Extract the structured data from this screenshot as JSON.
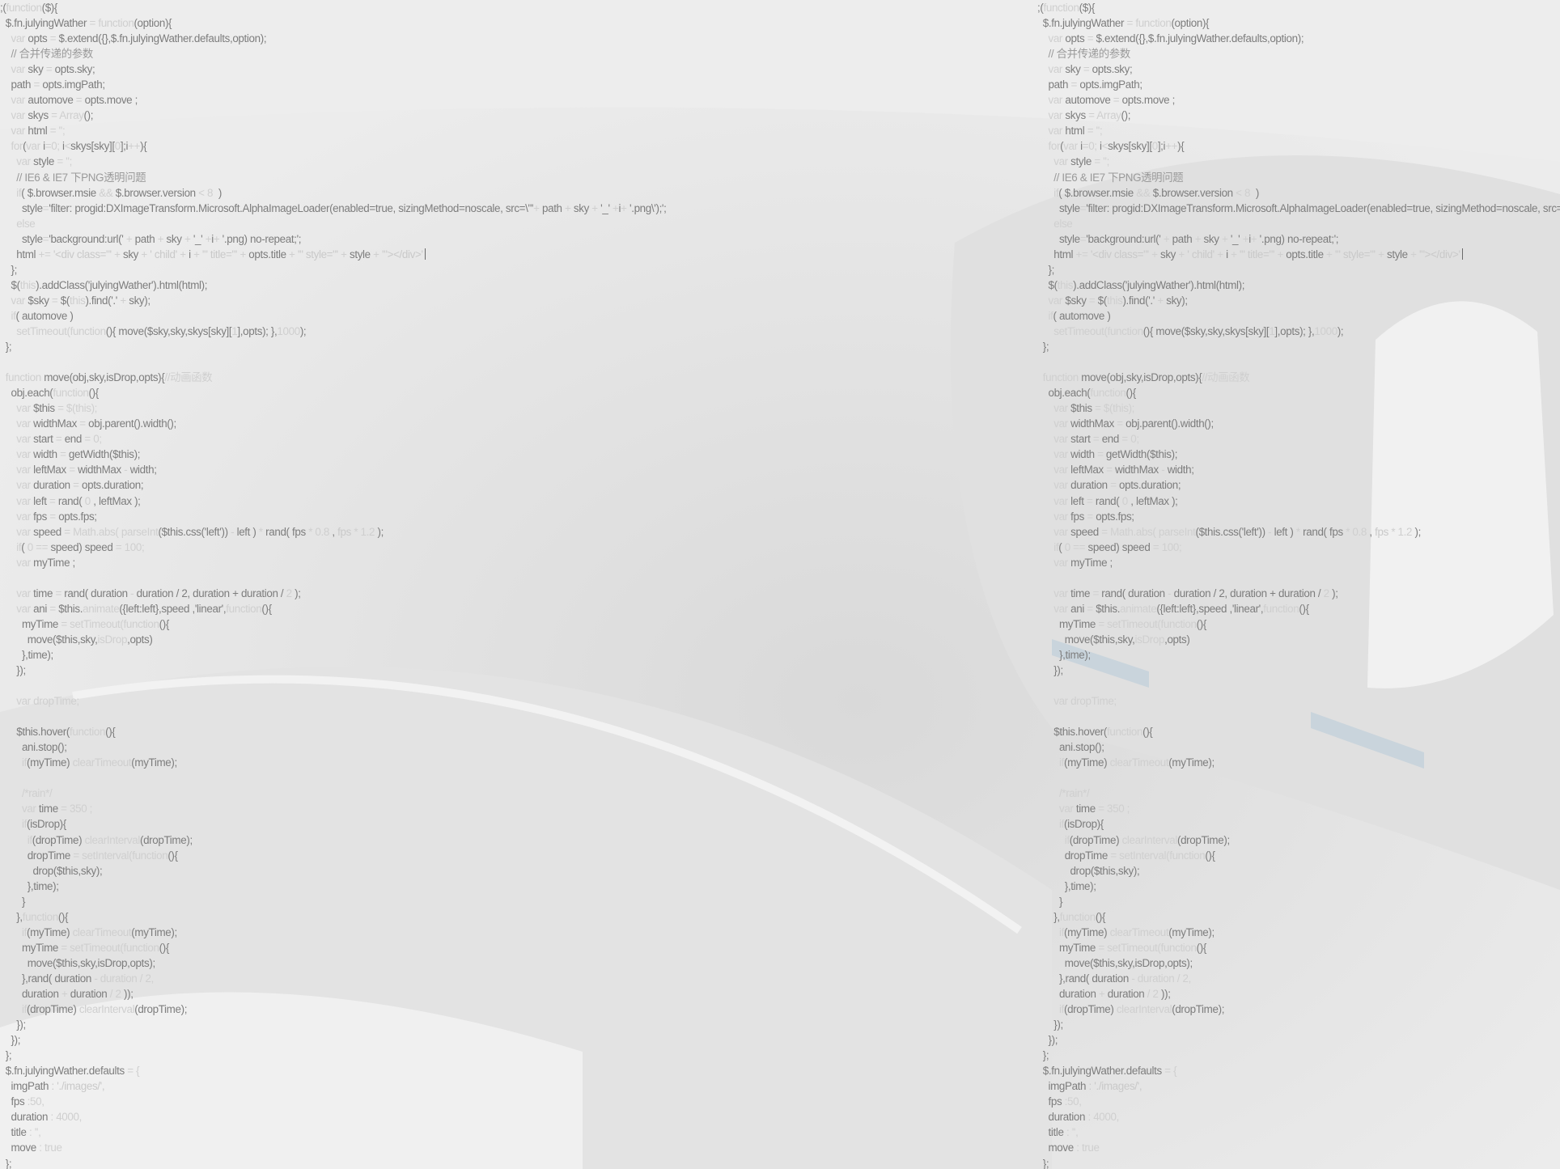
{
  "colors": {
    "background": "#e9e9e9",
    "code_text": "#7d7d7d",
    "keyword": "#cfcfcf",
    "string": "#c9c9c9",
    "comment": "#9a9a9a"
  },
  "code_lines": [
    [
      [
        ";(",
        ""
      ],
      [
        "function",
        "kw"
      ],
      [
        "($){",
        ""
      ]
    ],
    [
      [
        "  $.fn.julyingWather ",
        ""
      ],
      [
        "= function",
        "kw"
      ],
      [
        "(option){",
        ""
      ]
    ],
    [
      [
        "    ",
        ""
      ],
      [
        "var",
        "kw"
      ],
      [
        " opts ",
        ""
      ],
      [
        "=",
        "kw"
      ],
      [
        " $.extend({},$.fn.julyingWather.defaults,option);",
        ""
      ]
    ],
    [
      [
        "    // 合并传递的参数",
        "cm"
      ]
    ],
    [
      [
        "    ",
        ""
      ],
      [
        "var",
        "kw"
      ],
      [
        " sky ",
        ""
      ],
      [
        "=",
        "kw"
      ],
      [
        " opts.sky;",
        ""
      ]
    ],
    [
      [
        "    path ",
        ""
      ],
      [
        "=",
        "kw"
      ],
      [
        " opts.imgPath;",
        ""
      ]
    ],
    [
      [
        "    ",
        ""
      ],
      [
        "var",
        "kw"
      ],
      [
        " automove ",
        ""
      ],
      [
        "=",
        "kw"
      ],
      [
        " opts.move ;",
        ""
      ]
    ],
    [
      [
        "    ",
        ""
      ],
      [
        "var",
        "kw"
      ],
      [
        " skys ",
        ""
      ],
      [
        "= Array",
        "kw"
      ],
      [
        "();",
        ""
      ]
    ],
    [
      [
        "    ",
        ""
      ],
      [
        "var",
        "kw"
      ],
      [
        " html ",
        ""
      ],
      [
        "= '';",
        "kw"
      ]
    ],
    [
      [
        "    ",
        ""
      ],
      [
        "for",
        "kw"
      ],
      [
        "(",
        ""
      ],
      [
        "var",
        "kw"
      ],
      [
        " i",
        ""
      ],
      [
        "=0;",
        "kw"
      ],
      [
        " i",
        ""
      ],
      [
        "<",
        "kw"
      ],
      [
        "skys[sky][",
        ""
      ],
      [
        "0",
        "num"
      ],
      [
        "];i",
        ""
      ],
      [
        "++",
        "kw"
      ],
      [
        "){",
        ""
      ]
    ],
    [
      [
        "      ",
        ""
      ],
      [
        "var",
        "kw"
      ],
      [
        " style ",
        ""
      ],
      [
        "= '';",
        "kw"
      ]
    ],
    [
      [
        "      // IE6 & IE7 下PNG透明问题",
        "cm"
      ]
    ],
    [
      [
        "      ",
        ""
      ],
      [
        "if",
        "kw"
      ],
      [
        "( $.browser.msie ",
        ""
      ],
      [
        "&&",
        "kw"
      ],
      [
        " $.browser.version ",
        ""
      ],
      [
        "< 8",
        "kw"
      ],
      [
        "  )",
        ""
      ]
    ],
    [
      [
        "        style",
        ""
      ],
      [
        "=",
        "kw"
      ],
      [
        "'filter: progid:DXImageTransform.Microsoft.AlphaImageLoader(enabled=true, sizingMethod=noscale, src=\\\"'",
        ""
      ],
      [
        "+",
        "kw"
      ],
      [
        " path ",
        ""
      ],
      [
        "+",
        "kw"
      ],
      [
        " sky ",
        ""
      ],
      [
        "+",
        "kw"
      ],
      [
        " '_' ",
        ""
      ],
      [
        "+",
        "kw"
      ],
      [
        "i",
        ""
      ],
      [
        "+",
        "kw"
      ],
      [
        " '.png\\');';",
        ""
      ]
    ],
    [
      [
        "      ",
        ""
      ],
      [
        "else",
        "kw"
      ]
    ],
    [
      [
        "        style",
        ""
      ],
      [
        "=",
        "kw"
      ],
      [
        "'background:url(' ",
        ""
      ],
      [
        "+",
        "kw"
      ],
      [
        " path ",
        ""
      ],
      [
        "+",
        "kw"
      ],
      [
        " sky ",
        ""
      ],
      [
        "+",
        "kw"
      ],
      [
        " '_' ",
        ""
      ],
      [
        "+",
        "kw"
      ],
      [
        "i",
        ""
      ],
      [
        "+",
        "kw"
      ],
      [
        " '.png) no-repeat;';",
        ""
      ]
    ],
    [
      [
        "      html ",
        ""
      ],
      [
        "+= ",
        "kw"
      ],
      [
        "'<div class=\"' ",
        "str"
      ],
      [
        "+",
        "kw"
      ],
      [
        " sky ",
        ""
      ],
      [
        "+",
        "kw"
      ],
      [
        " ' child' ",
        "str"
      ],
      [
        "+",
        "kw"
      ],
      [
        " i ",
        ""
      ],
      [
        "+",
        "kw"
      ],
      [
        " '\" title=\"' ",
        "str"
      ],
      [
        "+",
        "kw"
      ],
      [
        " opts.title ",
        ""
      ],
      [
        "+",
        "kw"
      ],
      [
        " '\" style=\"' ",
        "str"
      ],
      [
        "+",
        "kw"
      ],
      [
        " style ",
        ""
      ],
      [
        "+",
        "kw"
      ],
      [
        " '\"></div>'",
        "str"
      ]
    ],
    [
      [
        "    };",
        ""
      ]
    ],
    [
      [
        "    $(",
        ""
      ],
      [
        "this",
        "kw"
      ],
      [
        ").addClass('julyingWather').html(html);",
        ""
      ]
    ],
    [
      [
        "    ",
        ""
      ],
      [
        "var",
        "kw"
      ],
      [
        " $sky ",
        ""
      ],
      [
        "= ",
        "kw"
      ],
      [
        "$(",
        ""
      ],
      [
        "this",
        "kw"
      ],
      [
        ").find('.' ",
        ""
      ],
      [
        "+",
        "kw"
      ],
      [
        " sky);",
        ""
      ]
    ],
    [
      [
        "    ",
        ""
      ],
      [
        "if",
        "kw"
      ],
      [
        "( automove )",
        ""
      ]
    ],
    [
      [
        "      ",
        ""
      ],
      [
        "setTimeout(function",
        "kw"
      ],
      [
        "(){ move($sky,sky,skys[sky][",
        ""
      ],
      [
        "1",
        "num"
      ],
      [
        "],opts); },",
        ""
      ],
      [
        "1000",
        "num"
      ],
      [
        ");",
        ""
      ]
    ],
    [
      [
        "  };",
        ""
      ]
    ],
    [
      [
        "",
        ""
      ]
    ],
    [
      [
        "  ",
        ""
      ],
      [
        "function",
        "kw"
      ],
      [
        " move(obj,sky,isDrop,opts){",
        ""
      ],
      [
        "//动画函数",
        "kw"
      ]
    ],
    [
      [
        "    obj.each(",
        ""
      ],
      [
        "function",
        "kw"
      ],
      [
        "(){",
        ""
      ]
    ],
    [
      [
        "      ",
        ""
      ],
      [
        "var",
        "kw"
      ],
      [
        " $this ",
        ""
      ],
      [
        "= $(this);",
        "kw"
      ]
    ],
    [
      [
        "      ",
        ""
      ],
      [
        "var",
        "kw"
      ],
      [
        " widthMax ",
        ""
      ],
      [
        "=",
        "kw"
      ],
      [
        " obj.parent().width();",
        ""
      ]
    ],
    [
      [
        "      ",
        ""
      ],
      [
        "var",
        "kw"
      ],
      [
        " start ",
        ""
      ],
      [
        "=",
        "kw"
      ],
      [
        " end ",
        ""
      ],
      [
        "= 0;",
        "kw"
      ]
    ],
    [
      [
        "      ",
        ""
      ],
      [
        "var",
        "kw"
      ],
      [
        " width ",
        ""
      ],
      [
        "=",
        "kw"
      ],
      [
        " getWidth($this);",
        ""
      ]
    ],
    [
      [
        "      ",
        ""
      ],
      [
        "var",
        "kw"
      ],
      [
        " leftMax ",
        ""
      ],
      [
        "=",
        "kw"
      ],
      [
        " widthMax ",
        ""
      ],
      [
        "-",
        "kw"
      ],
      [
        " width;",
        ""
      ]
    ],
    [
      [
        "      ",
        ""
      ],
      [
        "var",
        "kw"
      ],
      [
        " duration ",
        ""
      ],
      [
        "=",
        "kw"
      ],
      [
        " opts.duration;",
        ""
      ]
    ],
    [
      [
        "      ",
        ""
      ],
      [
        "var",
        "kw"
      ],
      [
        " left ",
        ""
      ],
      [
        "=",
        "kw"
      ],
      [
        " rand( ",
        ""
      ],
      [
        "0",
        "num"
      ],
      [
        " , leftMax );",
        ""
      ]
    ],
    [
      [
        "      ",
        ""
      ],
      [
        "var",
        "kw"
      ],
      [
        " fps ",
        ""
      ],
      [
        "=",
        "kw"
      ],
      [
        " opts.fps;",
        ""
      ]
    ],
    [
      [
        "      ",
        ""
      ],
      [
        "var",
        "kw"
      ],
      [
        " speed ",
        ""
      ],
      [
        "= Math.abs( parseInt",
        "kw"
      ],
      [
        "($this.css('left')) ",
        ""
      ],
      [
        "-",
        "kw"
      ],
      [
        " left ) ",
        ""
      ],
      [
        "*",
        "kw"
      ],
      [
        " rand( fps ",
        ""
      ],
      [
        "* 0.8",
        "num"
      ],
      [
        " , ",
        ""
      ],
      [
        "fps",
        "str"
      ],
      [
        " ",
        ""
      ],
      [
        "* 1.2",
        "num"
      ],
      [
        " );",
        ""
      ]
    ],
    [
      [
        "      ",
        ""
      ],
      [
        "if",
        "kw"
      ],
      [
        "( ",
        ""
      ],
      [
        "0 ==",
        "kw"
      ],
      [
        " speed) speed ",
        ""
      ],
      [
        "= 100;",
        "kw"
      ]
    ],
    [
      [
        "      ",
        ""
      ],
      [
        "var",
        "kw"
      ],
      [
        " myTime ;",
        ""
      ]
    ],
    [
      [
        "",
        ""
      ]
    ],
    [
      [
        "      ",
        ""
      ],
      [
        "var",
        "kw"
      ],
      [
        " time ",
        ""
      ],
      [
        "=",
        "kw"
      ],
      [
        " rand( duration ",
        ""
      ],
      [
        "-",
        "kw"
      ],
      [
        " duration / 2, duration + duration / ",
        ""
      ],
      [
        "2",
        "num"
      ],
      [
        " );",
        ""
      ]
    ],
    [
      [
        "      ",
        ""
      ],
      [
        "var",
        "kw"
      ],
      [
        " ani ",
        ""
      ],
      [
        "=",
        "kw"
      ],
      [
        " $this.",
        ""
      ],
      [
        "animate",
        "kw"
      ],
      [
        "({left:left},speed ,'linear',",
        ""
      ],
      [
        "function",
        "kw"
      ],
      [
        "(){",
        ""
      ]
    ],
    [
      [
        "        myTime ",
        ""
      ],
      [
        "= setTimeout(function",
        "kw"
      ],
      [
        "(){",
        ""
      ]
    ],
    [
      [
        "          move($this,sky,",
        ""
      ],
      [
        "isDrop",
        "kw"
      ],
      [
        ",opts)",
        ""
      ]
    ],
    [
      [
        "        },time);",
        ""
      ]
    ],
    [
      [
        "      });",
        ""
      ]
    ],
    [
      [
        "",
        ""
      ]
    ],
    [
      [
        "      ",
        ""
      ],
      [
        "var",
        "kw"
      ],
      [
        " dropTime;",
        "kw"
      ]
    ],
    [
      [
        "",
        ""
      ]
    ],
    [
      [
        "      $this.hover(",
        ""
      ],
      [
        "function",
        "kw"
      ],
      [
        "(){",
        ""
      ]
    ],
    [
      [
        "        ani.stop();",
        ""
      ]
    ],
    [
      [
        "        ",
        ""
      ],
      [
        "if",
        "kw"
      ],
      [
        "(myTime) ",
        ""
      ],
      [
        "clearTimeout",
        "kw"
      ],
      [
        "(myTime);",
        ""
      ]
    ],
    [
      [
        "",
        ""
      ]
    ],
    [
      [
        "        /*rain*/",
        "kw"
      ]
    ],
    [
      [
        "        ",
        ""
      ],
      [
        "var",
        "kw"
      ],
      [
        " time ",
        ""
      ],
      [
        "= 350 ;",
        "kw"
      ]
    ],
    [
      [
        "        ",
        ""
      ],
      [
        "if",
        "kw"
      ],
      [
        "(isDrop){",
        ""
      ]
    ],
    [
      [
        "          ",
        ""
      ],
      [
        "if",
        "kw"
      ],
      [
        "(dropTime) ",
        ""
      ],
      [
        "clearInterval",
        "kw"
      ],
      [
        "(dropTime);",
        ""
      ]
    ],
    [
      [
        "          dropTime ",
        ""
      ],
      [
        "= setInterval(function",
        "kw"
      ],
      [
        "(){",
        ""
      ]
    ],
    [
      [
        "            drop($this,sky);",
        ""
      ]
    ],
    [
      [
        "          },time);",
        ""
      ]
    ],
    [
      [
        "        }",
        ""
      ]
    ],
    [
      [
        "      },",
        ""
      ],
      [
        "function",
        "kw"
      ],
      [
        "(){",
        ""
      ]
    ],
    [
      [
        "        ",
        ""
      ],
      [
        "if",
        "kw"
      ],
      [
        "(myTime) ",
        ""
      ],
      [
        "clearTimeout",
        "kw"
      ],
      [
        "(myTime);",
        ""
      ]
    ],
    [
      [
        "        myTime ",
        ""
      ],
      [
        "= setTimeout(function",
        "kw"
      ],
      [
        "(){",
        ""
      ]
    ],
    [
      [
        "          move($this,sky,isDrop,opts);",
        ""
      ]
    ],
    [
      [
        "        },rand( duration ",
        ""
      ],
      [
        "- duration / 2,",
        "kw"
      ]
    ],
    [
      [
        "        duration ",
        ""
      ],
      [
        "+",
        "kw"
      ],
      [
        " duration ",
        ""
      ],
      [
        "/ 2",
        "kw"
      ],
      [
        " ));",
        ""
      ]
    ],
    [
      [
        "        ",
        ""
      ],
      [
        "if",
        "kw"
      ],
      [
        "(dropTime) ",
        ""
      ],
      [
        "clearInterval",
        "kw"
      ],
      [
        "(dropTime);",
        ""
      ]
    ],
    [
      [
        "      });",
        ""
      ]
    ],
    [
      [
        "    });",
        ""
      ]
    ],
    [
      [
        "  };",
        ""
      ]
    ],
    [
      [
        "  $.fn.julyingWather.defaults ",
        ""
      ],
      [
        "= {",
        "kw"
      ]
    ],
    [
      [
        "    imgPath ",
        ""
      ],
      [
        ": './images/',",
        "str"
      ]
    ],
    [
      [
        "    fps ",
        ""
      ],
      [
        ":50,",
        "kw"
      ]
    ],
    [
      [
        "    duration ",
        ""
      ],
      [
        ": 4000,",
        "kw"
      ]
    ],
    [
      [
        "    title ",
        ""
      ],
      [
        ": '',",
        "kw"
      ]
    ],
    [
      [
        "    move ",
        ""
      ],
      [
        ": true",
        "kw"
      ]
    ],
    [
      [
        "  };",
        ""
      ]
    ]
  ]
}
